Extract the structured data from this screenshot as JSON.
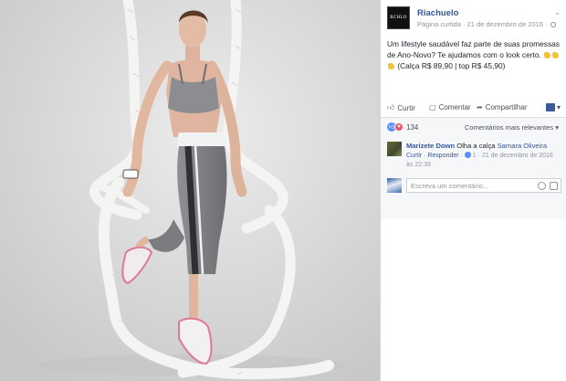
{
  "post": {
    "page_name": "Riachuelo",
    "logo_text": "RCHLO",
    "meta": "Página curtida · 21 de dezembro de 2016 ·",
    "menu_icon": "chevron-down-icon",
    "text_line1": "Um lifestyle saudável faz parte de suas promessas",
    "text_line2": "de Ano-Novo? Te ajudamos com o look certo.",
    "text_line3": "(Calça R$ 89,90 | top R$ 45,90)"
  },
  "actions": {
    "like": "Curtir",
    "comment": "Comentar",
    "share": "Compartilhar"
  },
  "reactions": {
    "count": "134",
    "sort": "Comentários mais relevantes ▾"
  },
  "comment": {
    "author": "Marizete Down",
    "text": " Olha a calça ",
    "mention": "Samara Oliveira",
    "like_link": "Curtir",
    "reply_link": "Responder",
    "likes": "1",
    "date": "21 de dezembro de 2016 às 22:39"
  },
  "reply": {
    "placeholder": "Escreva um comentário..."
  },
  "colors": {
    "link_blue": "#365899",
    "like_blue": "#5890ff",
    "love_red": "#f25268",
    "photo_bg": "#d9d8d9"
  }
}
